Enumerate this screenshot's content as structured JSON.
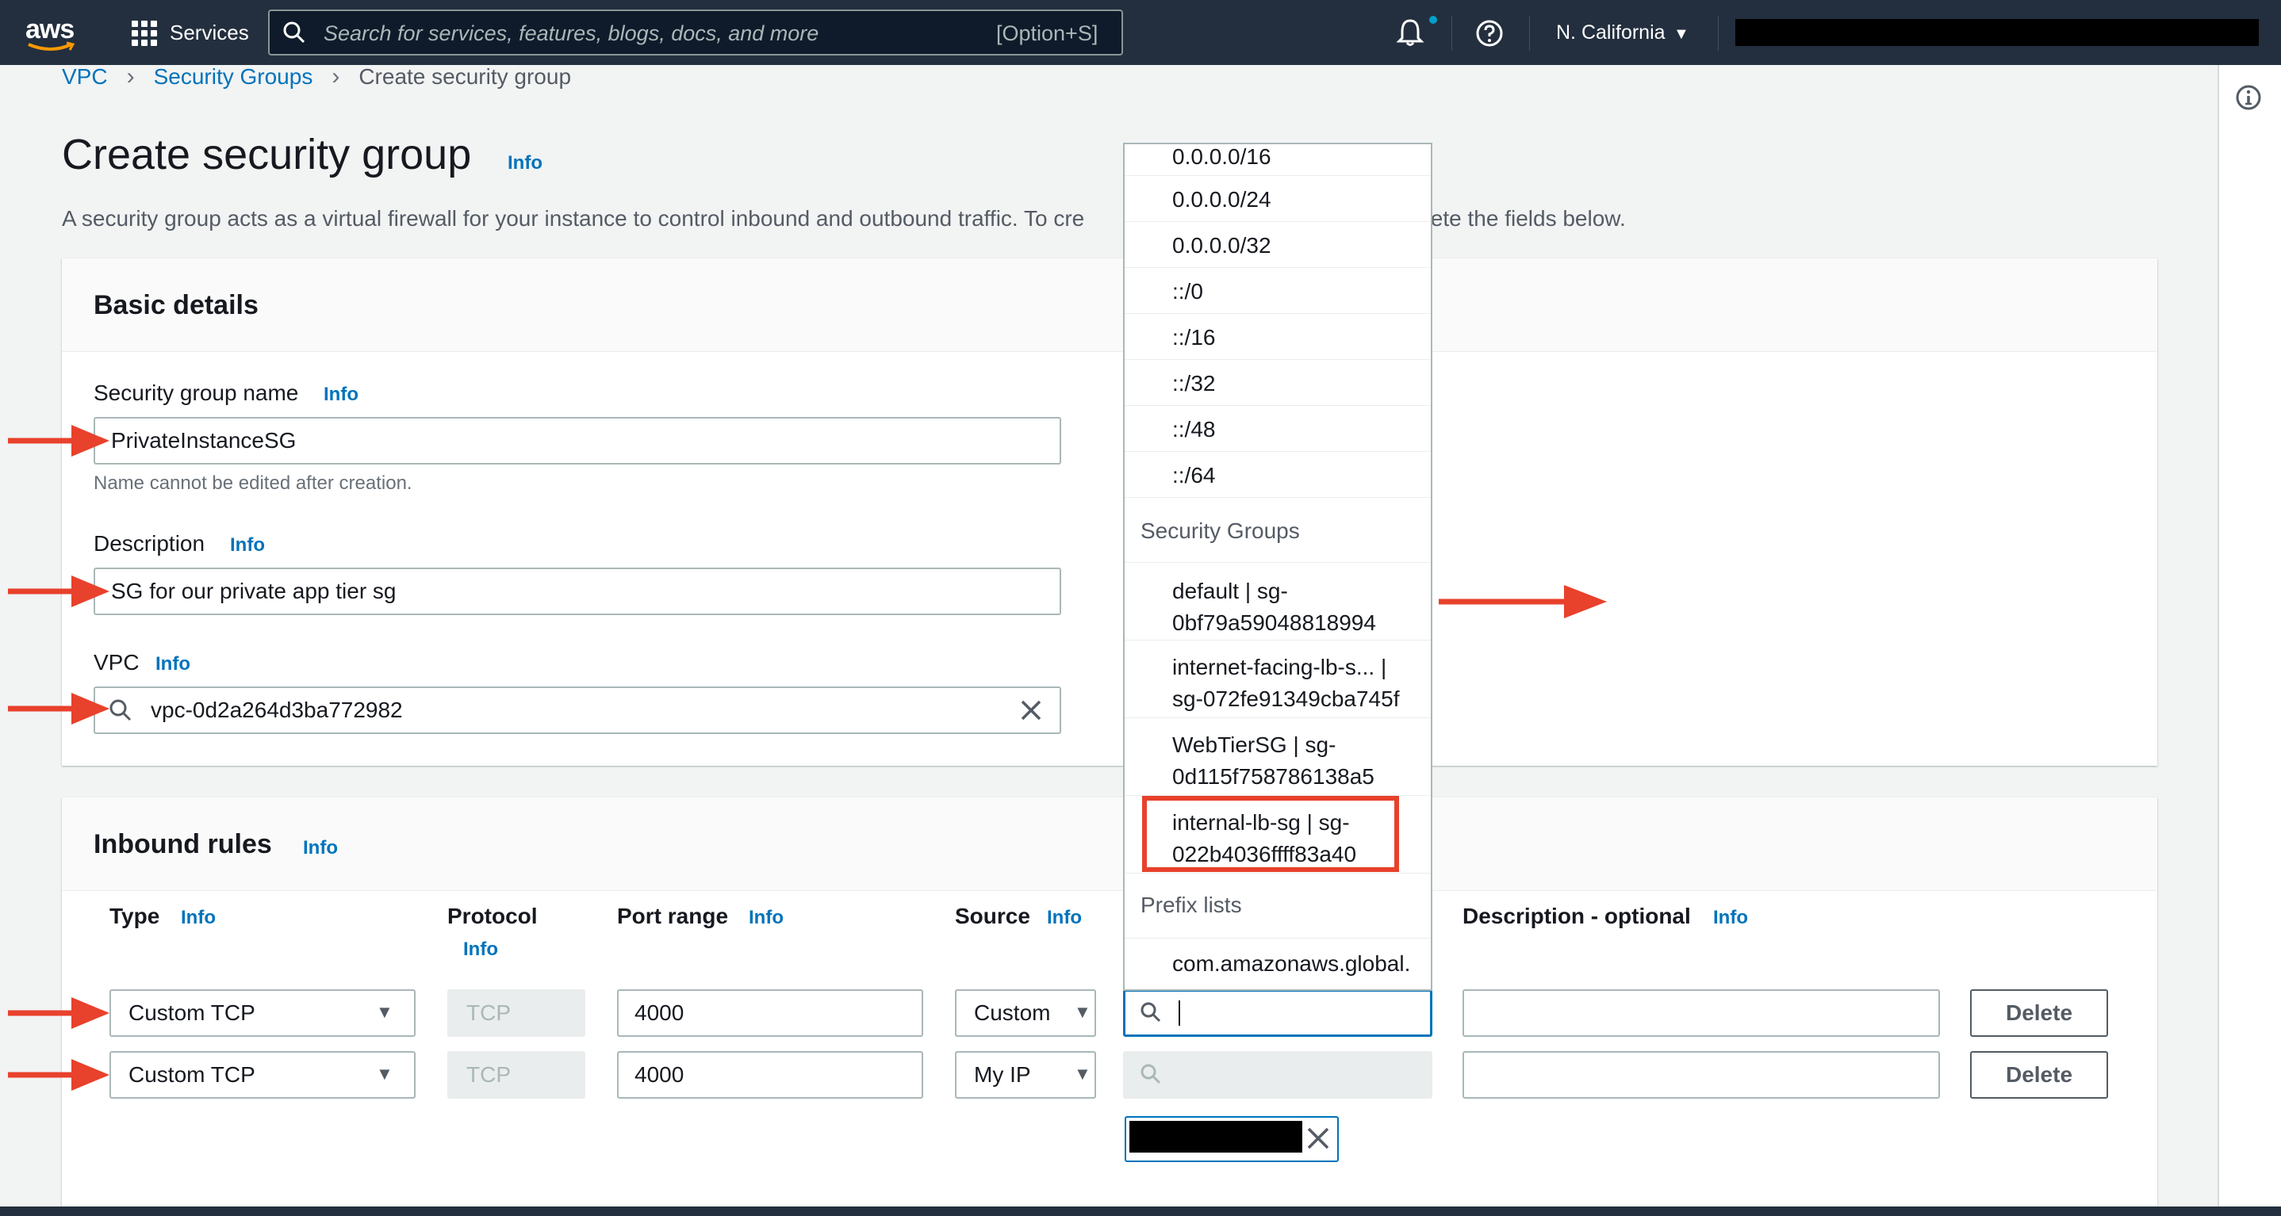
{
  "nav": {
    "logo": "aws",
    "services_label": "Services",
    "search_placeholder": "Search for services, features, blogs, docs, and more",
    "search_shortcut": "[Option+S]",
    "region": "N. California",
    "icons": [
      "services-grid-icon",
      "search-icon",
      "bell-icon",
      "help-icon"
    ]
  },
  "breadcrumb": {
    "items": [
      "VPC",
      "Security Groups"
    ],
    "current": "Create security group"
  },
  "page": {
    "title": "Create security group",
    "info": "Info",
    "description": "A security group acts as a virtual firewall for your instance to control inbound and outbound traffic. To cre",
    "description_tail": "plete the fields below."
  },
  "basic": {
    "title": "Basic details",
    "name_label": "Security group name",
    "name_value": "PrivateInstanceSG",
    "name_hint": "Name cannot be edited after creation.",
    "desc_label": "Description",
    "desc_value": "SG for our private app tier sg",
    "vpc_label": "VPC",
    "vpc_value": "vpc-0d2a264d3ba772982",
    "info": "Info"
  },
  "inbound": {
    "title": "Inbound rules",
    "info": "Info",
    "columns": {
      "type": "Type",
      "protocol": "Protocol",
      "port": "Port range",
      "source": "Source",
      "description": "Description - optional"
    },
    "rows": [
      {
        "type": "Custom TCP",
        "protocol": "TCP",
        "port": "4000",
        "source": "Custom",
        "delete": "Delete"
      },
      {
        "type": "Custom TCP",
        "protocol": "TCP",
        "port": "4000",
        "source": "My IP",
        "delete": "Delete"
      }
    ]
  },
  "dropdown": {
    "cidr_items": [
      "0.0.0.0/16",
      "0.0.0.0/24",
      "0.0.0.0/32",
      "::/0",
      "::/16",
      "::/32",
      "::/48",
      "::/64"
    ],
    "sg_group_label": "Security Groups",
    "sg_items": [
      {
        "line1": "default | sg-",
        "line2": "0bf79a59048818994"
      },
      {
        "line1": "internet-facing-lb-s... |",
        "line2": "sg-072fe91349cba745f"
      },
      {
        "line1": "WebTierSG | sg-",
        "line2": "0d115f758786138a5"
      },
      {
        "line1": "internal-lb-sg | sg-",
        "line2": "022b4036ffff83a40"
      }
    ],
    "prefix_group_label": "Prefix lists",
    "prefix_item": "com.amazonaws.global."
  },
  "colors": {
    "nav_bg": "#232f3e",
    "link": "#0073bb",
    "annotation": "#e8412c"
  }
}
